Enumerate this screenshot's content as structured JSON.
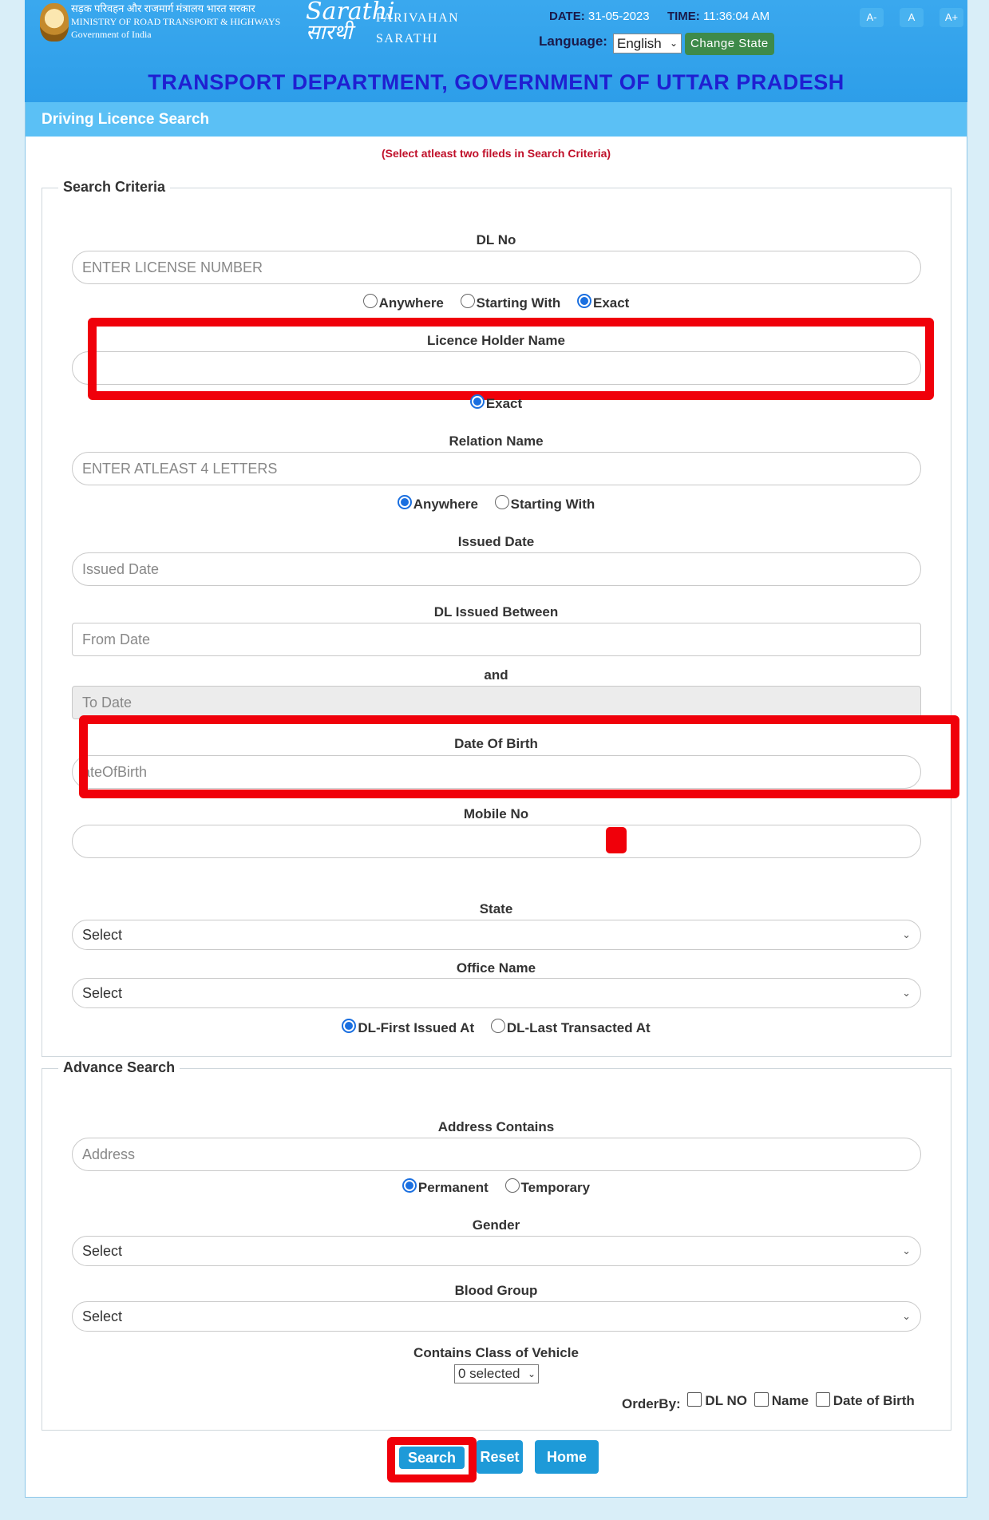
{
  "header": {
    "ministry_hindi": "सड़क परिवहन और राजमार्ग मंत्रालय भारत सरकार",
    "ministry_en": "MINISTRY OF ROAD TRANSPORT & HIGHWAYS",
    "gov": "Government of India",
    "logo_en": "Sarathi",
    "logo_hi": "सारथी",
    "brand_line1": "PARIVAHAN",
    "brand_line2": "SARATHI",
    "date_label": "DATE:",
    "date_value": "31-05-2023",
    "time_label": "TIME:",
    "time_value": "11:36:04 AM",
    "font_small": "A-",
    "font_normal": "A",
    "font_large": "A+",
    "language_label": "Language:",
    "language_value": "English",
    "change_state": "Change State",
    "dept_title": "TRANSPORT DEPARTMENT, GOVERNMENT OF UTTAR PRADESH"
  },
  "panel": {
    "title": "Driving Licence Search",
    "note": "(Select atleast two fileds in Search Criteria)"
  },
  "search_criteria": {
    "legend": "Search Criteria",
    "dl_no": {
      "label": "DL No",
      "placeholder": "ENTER LICENSE NUMBER"
    },
    "dl_match": {
      "anywhere": "Anywhere",
      "starting": "Starting With",
      "exact": "Exact",
      "selected": "Exact"
    },
    "holder_name": {
      "label": "Licence Holder Name",
      "value": ""
    },
    "holder_match": {
      "exact": "Exact"
    },
    "relation_name": {
      "label": "Relation Name",
      "placeholder": "ENTER ATLEAST 4 LETTERS"
    },
    "relation_match": {
      "anywhere": "Anywhere",
      "starting": "Starting With",
      "selected": "Anywhere"
    },
    "issued_date": {
      "label": "Issued Date",
      "placeholder": "Issued Date"
    },
    "issued_between": {
      "label": "DL Issued Between",
      "from_placeholder": "From Date",
      "and_label": "and",
      "to_placeholder": "To Date"
    },
    "dob": {
      "label": "Date Of Birth",
      "placeholder": "ateOfBirth"
    },
    "mobile": {
      "label": "Mobile No",
      "value": ""
    },
    "state": {
      "label": "State",
      "value": "Select"
    },
    "office": {
      "label": "Office Name",
      "value": "Select"
    },
    "office_match": {
      "first": "DL-First Issued At",
      "last": "DL-Last Transacted At",
      "selected": "DL-First Issued At"
    }
  },
  "advance_search": {
    "legend": "Advance Search",
    "address": {
      "label": "Address Contains",
      "placeholder": "Address"
    },
    "address_type": {
      "permanent": "Permanent",
      "temporary": "Temporary",
      "selected": "Permanent"
    },
    "gender": {
      "label": "Gender",
      "value": "Select"
    },
    "blood_group": {
      "label": "Blood Group",
      "value": "Select"
    },
    "cov": {
      "label": "Contains Class of Vehicle",
      "value": "0 selected"
    },
    "order_by": {
      "label": "OrderBy:",
      "dl_no": "DL NO",
      "name": "Name",
      "dob": "Date of Birth"
    }
  },
  "buttons": {
    "search": "Search",
    "reset": "Reset",
    "home": "Home"
  },
  "colors": {
    "header_blue": "#2d9ee9",
    "title_blue": "#1f1fd1",
    "panel_blue": "#5bc0f5",
    "note_red": "#c0102a",
    "highlight_red": "#f0000a",
    "button_blue": "#1e9ad8",
    "change_state_green": "#3e8a4a"
  }
}
